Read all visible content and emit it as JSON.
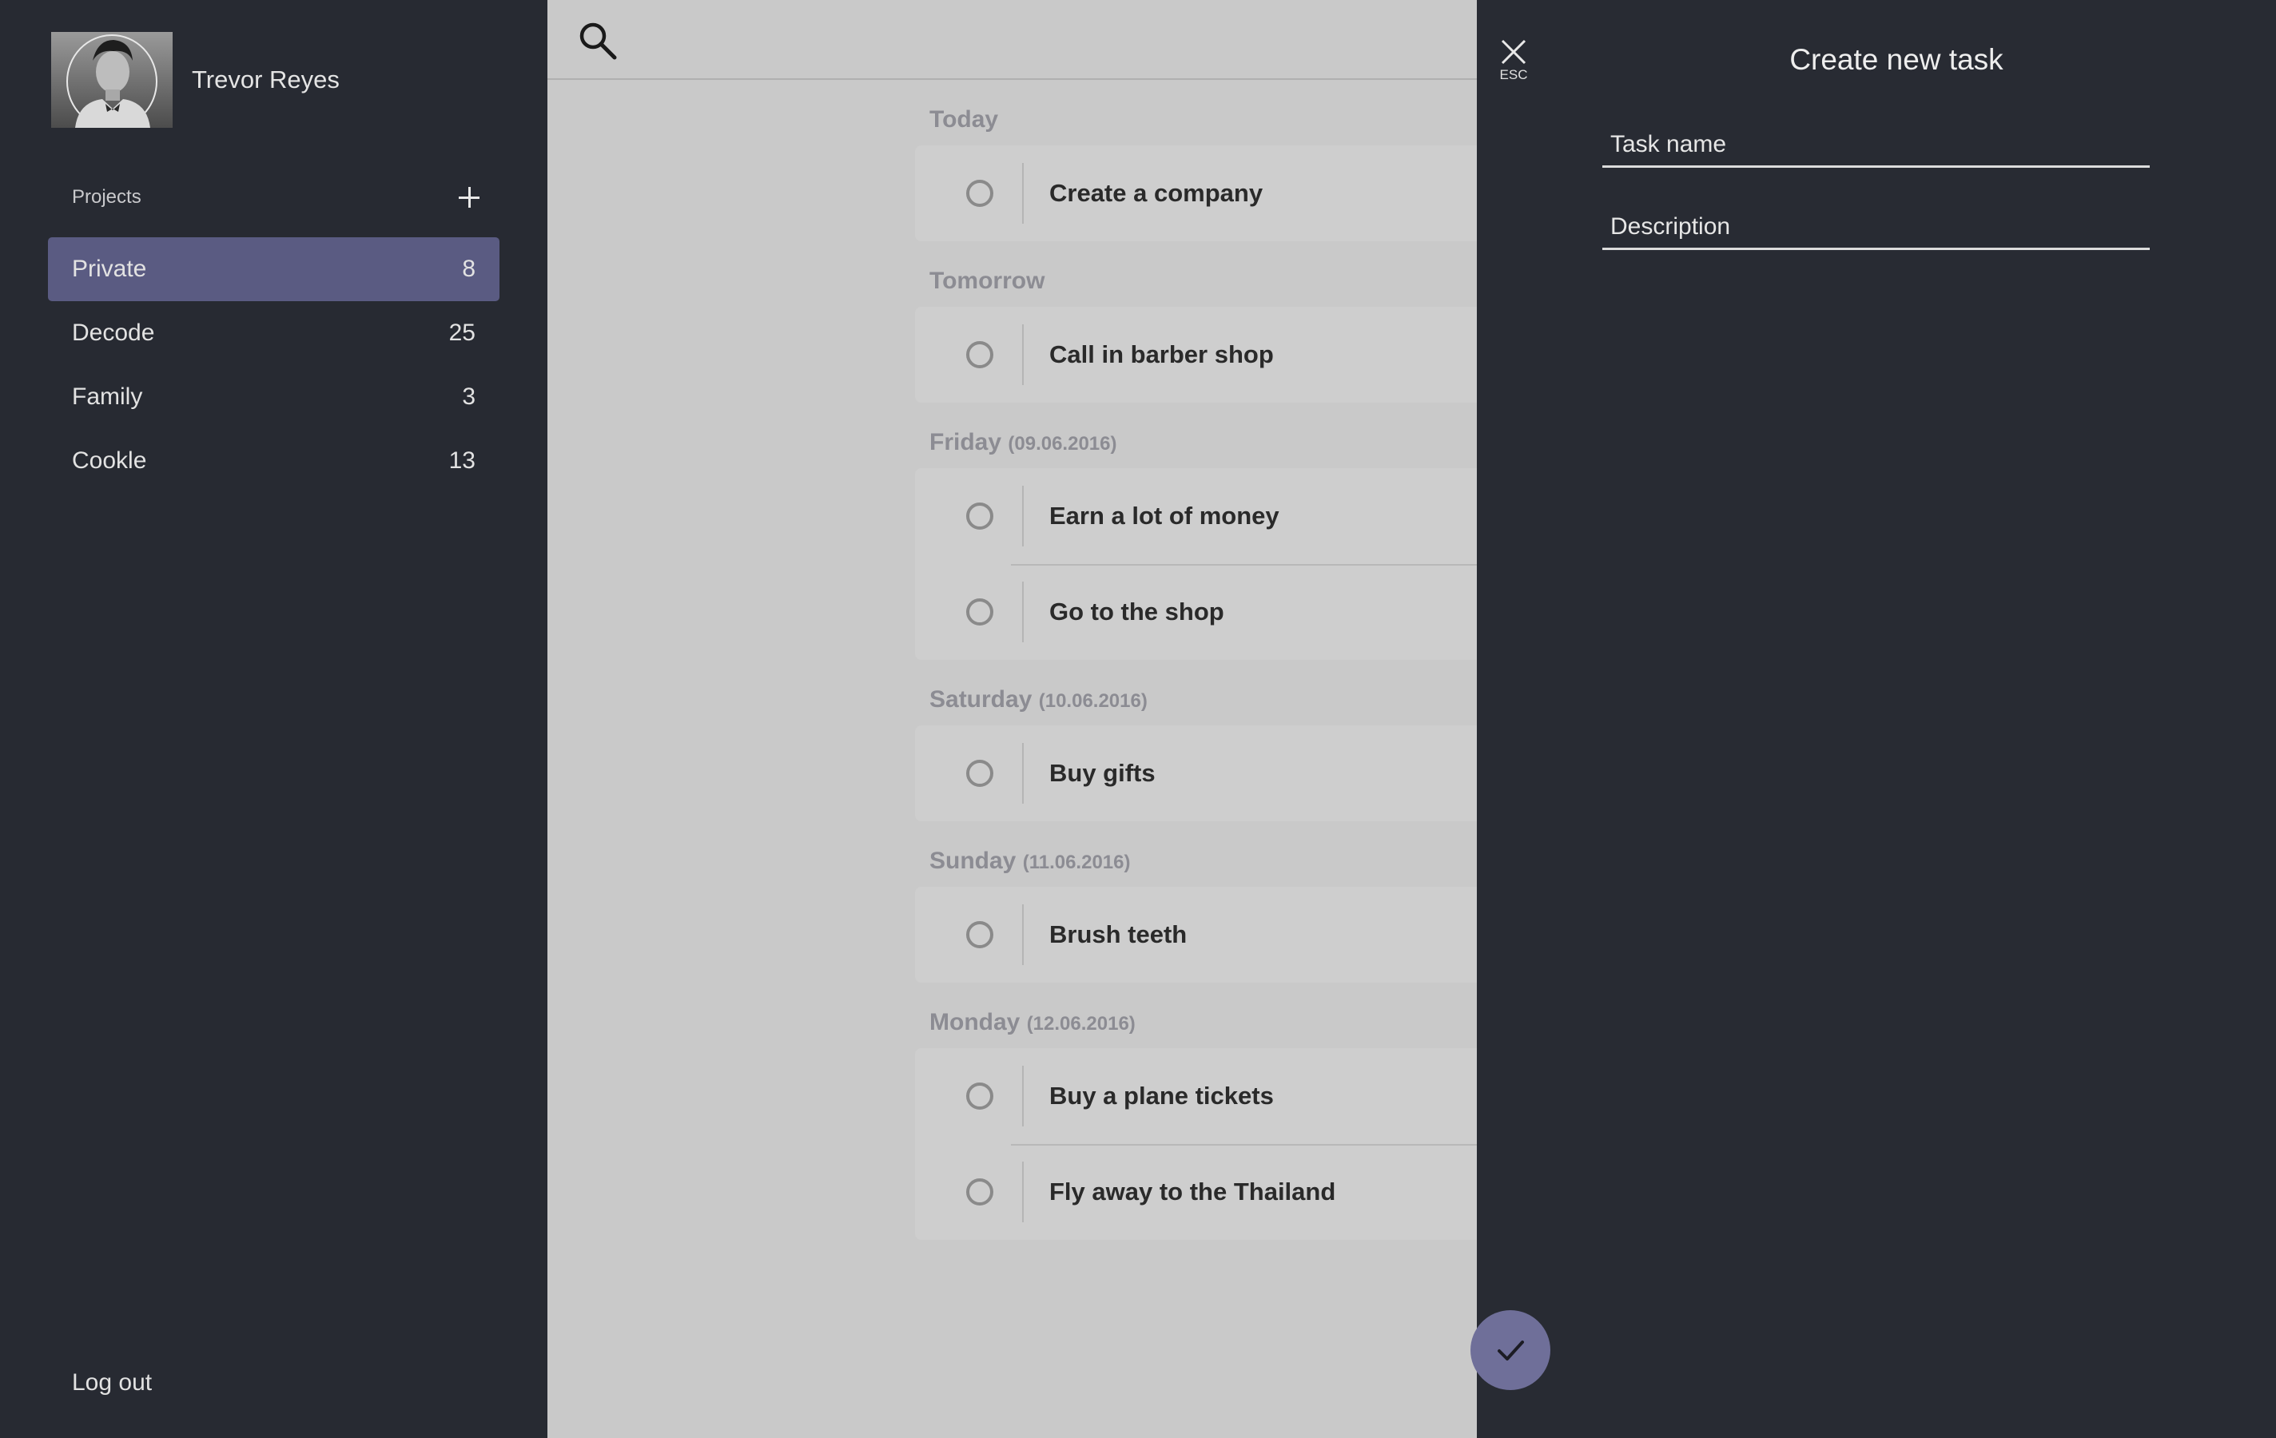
{
  "user": {
    "name": "Trevor Reyes"
  },
  "sidebar": {
    "projects_label": "Projects",
    "items": [
      {
        "label": "Private",
        "count": "8",
        "active": true
      },
      {
        "label": "Decode",
        "count": "25"
      },
      {
        "label": "Family",
        "count": "3"
      },
      {
        "label": "Cookle",
        "count": "13"
      }
    ],
    "logout_label": "Log out"
  },
  "main": {
    "groups": [
      {
        "title": "Today",
        "date": "",
        "tasks": [
          "Create a company"
        ]
      },
      {
        "title": "Tomorrow",
        "date": "",
        "tasks": [
          "Call in barber shop"
        ]
      },
      {
        "title": "Friday",
        "date": "(09.06.2016)",
        "tasks": [
          "Earn a lot of money",
          "Go to the shop"
        ]
      },
      {
        "title": "Saturday",
        "date": "(10.06.2016)",
        "tasks": [
          "Buy gifts"
        ]
      },
      {
        "title": "Sunday",
        "date": "(11.06.2016)",
        "tasks": [
          "Brush teeth"
        ]
      },
      {
        "title": "Monday",
        "date": "(12.06.2016)",
        "tasks": [
          "Buy a plane tickets",
          "Fly away to the Thailand"
        ]
      }
    ]
  },
  "panel": {
    "title": "Create new task",
    "esc_label": "ESC",
    "task_name_placeholder": "Task name",
    "description_placeholder": "Description"
  },
  "colors": {
    "sidebar_bg": "#272a32",
    "active_project": "#5a5b82",
    "confirm_button": "#6f6f99",
    "main_bg": "#c9c9c9"
  }
}
